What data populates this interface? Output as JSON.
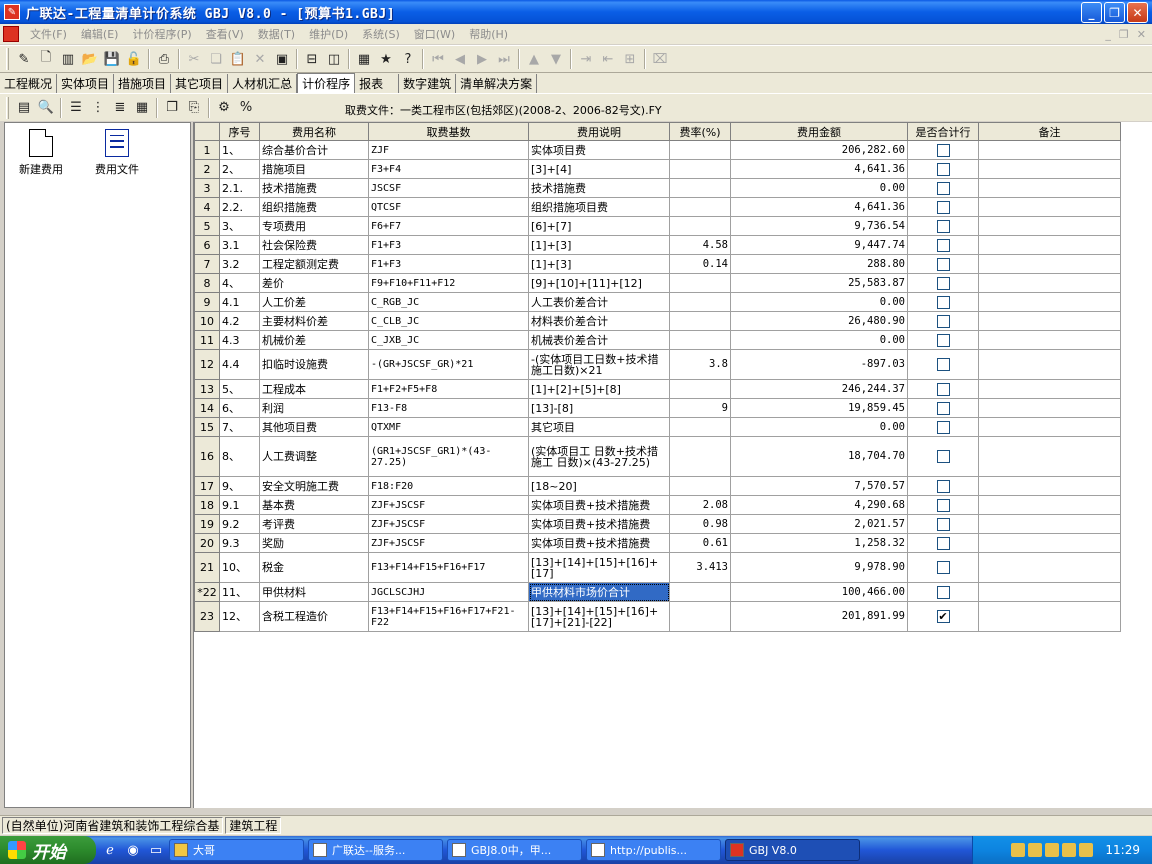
{
  "window": {
    "title": "广联达-工程量清单计价系统 GBJ V8.0 - [预算书1.GBJ]"
  },
  "menu": [
    "文件(F)",
    "编辑(E)",
    "计价程序(P)",
    "查看(V)",
    "数据(T)",
    "维护(D)",
    "系统(S)",
    "窗口(W)",
    "帮助(H)"
  ],
  "tabs": [
    "工程概况",
    "实体项目",
    "措施项目",
    "其它项目",
    "人材机汇总",
    "计价程序",
    "报表",
    "数字建筑",
    "清单解决方案"
  ],
  "active_tab": 5,
  "fee_file_label": "取费文件：一类工程市区(包括郊区)(2008-2、2006-82号文).FY",
  "left_pane": [
    {
      "label": "新建费用",
      "icon": "new-doc-icon"
    },
    {
      "label": "费用文件",
      "icon": "fee-file-icon"
    }
  ],
  "columns": [
    "",
    "序号",
    "费用名称",
    "取费基数",
    "费用说明",
    "费率(%)",
    "费用金额",
    "是否合计行",
    "备注"
  ],
  "rows": [
    {
      "n": "1",
      "seq": "1、",
      "name": "综合基价合计",
      "base": "ZJF",
      "desc": "实体项目费",
      "rate": "",
      "amount": "206,282.60",
      "total": false
    },
    {
      "n": "2",
      "seq": "2、",
      "name": "措施项目",
      "base": "F3+F4",
      "desc": "[3]+[4]",
      "rate": "",
      "amount": "4,641.36",
      "total": false
    },
    {
      "n": "3",
      "seq": "2.1.",
      "name": "技术措施费",
      "base": "JSCSF",
      "desc": "技术措施费",
      "rate": "",
      "amount": "0.00",
      "total": false
    },
    {
      "n": "4",
      "seq": "2.2.",
      "name": "组织措施费",
      "base": "QTCSF",
      "desc": "组织措施项目费",
      "rate": "",
      "amount": "4,641.36",
      "total": false
    },
    {
      "n": "5",
      "seq": "3、",
      "name": "专项费用",
      "base": "F6+F7",
      "desc": "[6]+[7]",
      "rate": "",
      "amount": "9,736.54",
      "total": false
    },
    {
      "n": "6",
      "seq": "3.1",
      "name": "社会保险费",
      "base": "F1+F3",
      "desc": "[1]+[3]",
      "rate": "4.58",
      "amount": "9,447.74",
      "total": false
    },
    {
      "n": "7",
      "seq": "3.2",
      "name": "工程定额测定费",
      "base": "F1+F3",
      "desc": "[1]+[3]",
      "rate": "0.14",
      "amount": "288.80",
      "total": false
    },
    {
      "n": "8",
      "seq": "4、",
      "name": "差价",
      "base": "F9+F10+F11+F12",
      "desc": "[9]+[10]+[11]+[12]",
      "rate": "",
      "amount": "25,583.87",
      "total": false
    },
    {
      "n": "9",
      "seq": "4.1",
      "name": "人工价差",
      "base": "C_RGB_JC",
      "desc": "人工表价差合计",
      "rate": "",
      "amount": "0.00",
      "total": false
    },
    {
      "n": "10",
      "seq": "4.2",
      "name": "主要材料价差",
      "base": "C_CLB_JC",
      "desc": "材料表价差合计",
      "rate": "",
      "amount": "26,480.90",
      "total": false
    },
    {
      "n": "11",
      "seq": "4.3",
      "name": "机械价差",
      "base": "C_JXB_JC",
      "desc": "机械表价差合计",
      "rate": "",
      "amount": "0.00",
      "total": false
    },
    {
      "n": "12",
      "seq": "4.4",
      "name": "扣临时设施费",
      "base": "-(GR+JSCSF_GR)*21",
      "desc": "-(实体项目工日数+技术措施工日数)×21",
      "rate": "3.8",
      "amount": "-897.03",
      "total": false
    },
    {
      "n": "13",
      "seq": "5、",
      "name": "工程成本",
      "base": "F1+F2+F5+F8",
      "desc": "[1]+[2]+[5]+[8]",
      "rate": "",
      "amount": "246,244.37",
      "total": false
    },
    {
      "n": "14",
      "seq": "6、",
      "name": "利润",
      "base": "F13-F8",
      "desc": "[13]-[8]",
      "rate": "9",
      "amount": "19,859.45",
      "total": false
    },
    {
      "n": "15",
      "seq": "7、",
      "name": "其他项目费",
      "base": "QTXMF",
      "desc": "其它项目",
      "rate": "",
      "amount": "0.00",
      "total": false
    },
    {
      "n": "16",
      "seq": "8、",
      "name": "人工费调整",
      "base": "(GR1+JSCSF_GR1)*(43-27.25)",
      "desc": "(实体项目工 日数+技术措施工 日数)×(43-27.25)",
      "rate": "",
      "amount": "18,704.70",
      "total": false
    },
    {
      "n": "17",
      "seq": "9、",
      "name": "安全文明施工费",
      "base": "F18:F20",
      "desc": "[18~20]",
      "rate": "",
      "amount": "7,570.57",
      "total": false
    },
    {
      "n": "18",
      "seq": "9.1",
      "name": "基本费",
      "base": "ZJF+JSCSF",
      "desc": "实体项目费+技术措施费",
      "rate": "2.08",
      "amount": "4,290.68",
      "total": false
    },
    {
      "n": "19",
      "seq": "9.2",
      "name": "考评费",
      "base": "ZJF+JSCSF",
      "desc": "实体项目费+技术措施费",
      "rate": "0.98",
      "amount": "2,021.57",
      "total": false
    },
    {
      "n": "20",
      "seq": "9.3",
      "name": "奖励",
      "base": "ZJF+JSCSF",
      "desc": "实体项目费+技术措施费",
      "rate": "0.61",
      "amount": "1,258.32",
      "total": false
    },
    {
      "n": "21",
      "seq": "10、",
      "name": "税金",
      "base": "F13+F14+F15+F16+F17",
      "desc": "[13]+[14]+[15]+[16]+[17]",
      "rate": "3.413",
      "amount": "9,978.90",
      "total": false
    },
    {
      "n": "*22",
      "seq": "11、",
      "name": "甲供材料",
      "base": "JGCLSCJHJ",
      "desc": "甲供材料市场价合计",
      "rate": "",
      "amount": "100,466.00",
      "total": false,
      "selected": true
    },
    {
      "n": "23",
      "seq": "12、",
      "name": "含税工程造价",
      "base": "F13+F14+F15+F16+F17+F21-F22",
      "desc": "[13]+[14]+[15]+[16]+[17]+[21]-[22]",
      "rate": "",
      "amount": "201,891.99",
      "total": true
    }
  ],
  "status": {
    "panel1": "(自然单位)河南省建筑和装饰工程综合基",
    "panel2": "建筑工程"
  },
  "taskbar": {
    "start": "开始",
    "tasks": [
      "大哥",
      "广联达--服务...",
      "GBJ8.0中，甲...",
      "http://publis...",
      "GBJ V8.0"
    ],
    "active_task": 4,
    "clock": "11:29"
  }
}
